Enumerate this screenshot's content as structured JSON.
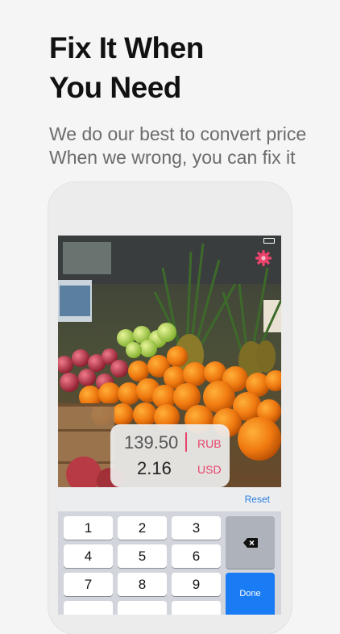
{
  "header": {
    "title_line1": "Fix It When",
    "title_line2": "You Need",
    "subtitle_line1": "We do our best to convert price",
    "subtitle_line2": "When we wrong, you can fix it"
  },
  "converter": {
    "source_value": "139.50",
    "source_currency": "RUB",
    "target_value": "2.16",
    "target_currency": "USD"
  },
  "toolbar": {
    "reset_label": "Reset"
  },
  "keypad": {
    "keys": [
      "1",
      "2",
      "3",
      "4",
      "5",
      "6",
      "7",
      "8",
      "9"
    ],
    "done_label": "Done"
  },
  "colors": {
    "accent": "#e8436a",
    "link": "#2b7fe0",
    "done": "#1a7cf5"
  },
  "icons": {
    "settings": "gear-icon",
    "backspace": "backspace-icon"
  }
}
